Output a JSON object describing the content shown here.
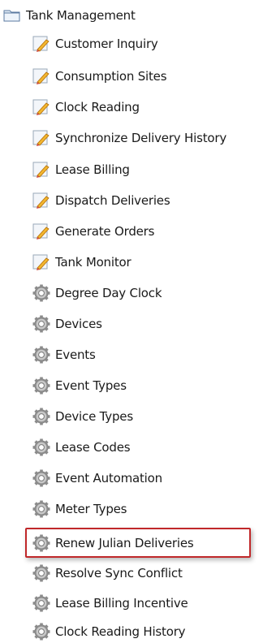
{
  "tree": {
    "root": {
      "label": "Tank Management",
      "icon": "folder-icon"
    },
    "items": [
      {
        "label": "Customer Inquiry",
        "icon": "form-edit-icon"
      },
      {
        "label": "Consumption Sites",
        "icon": "form-edit-icon"
      },
      {
        "label": "Clock Reading",
        "icon": "form-edit-icon"
      },
      {
        "label": "Synchronize Delivery History",
        "icon": "form-edit-icon"
      },
      {
        "label": "Lease Billing",
        "icon": "form-edit-icon"
      },
      {
        "label": "Dispatch Deliveries",
        "icon": "form-edit-icon"
      },
      {
        "label": "Generate Orders",
        "icon": "form-edit-icon"
      },
      {
        "label": "Tank Monitor",
        "icon": "form-edit-icon"
      },
      {
        "label": "Degree Day Clock",
        "icon": "gear-icon"
      },
      {
        "label": "Devices",
        "icon": "gear-icon"
      },
      {
        "label": "Events",
        "icon": "gear-icon"
      },
      {
        "label": "Event Types",
        "icon": "gear-icon"
      },
      {
        "label": "Device Types",
        "icon": "gear-icon"
      },
      {
        "label": "Lease Codes",
        "icon": "gear-icon"
      },
      {
        "label": "Event Automation",
        "icon": "gear-icon"
      },
      {
        "label": "Meter Types",
        "icon": "gear-icon"
      },
      {
        "label": "Renew Julian Deliveries",
        "icon": "gear-icon",
        "highlighted": true
      },
      {
        "label": "Resolve Sync Conflict",
        "icon": "gear-icon"
      },
      {
        "label": "Lease Billing Incentive",
        "icon": "gear-icon"
      },
      {
        "label": "Clock Reading History",
        "icon": "gear-icon"
      }
    ]
  },
  "colors": {
    "highlight_border": "#c0282a",
    "text": "#1a1a1a"
  }
}
